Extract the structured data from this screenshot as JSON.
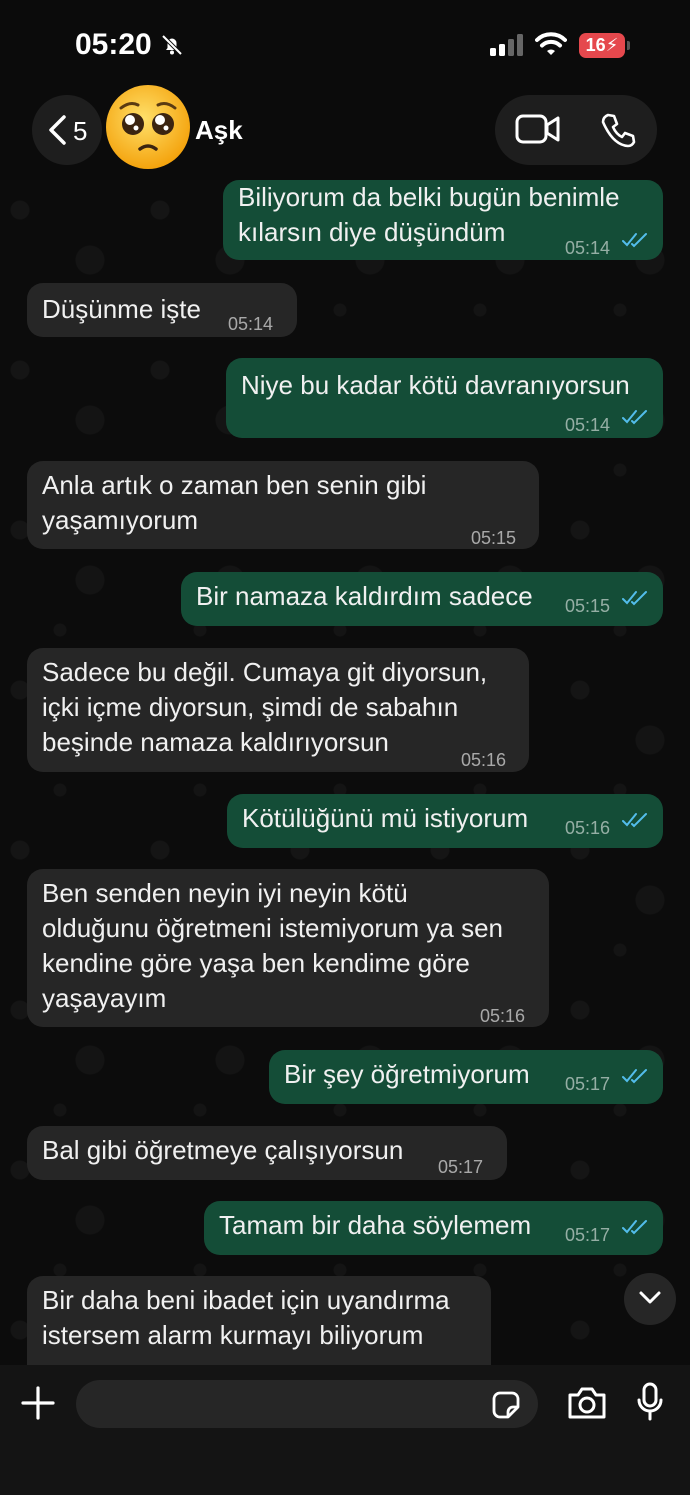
{
  "status_bar": {
    "time": "05:20",
    "battery": "16"
  },
  "header": {
    "back_count": "5",
    "contact_name": "Aşk"
  },
  "messages": [
    {
      "text": "Biliyorum da belki bugün benimle\nkılarsın diye düşündüm",
      "time": "05:14",
      "direction": "out"
    },
    {
      "text": "Düşünme işte",
      "time": "05:14",
      "direction": "in"
    },
    {
      "text": "Niye bu kadar kötü davranıyorsun",
      "time": "05:14",
      "direction": "out"
    },
    {
      "text": "Anla artık o zaman ben senin gibi\nyaşamıyorum",
      "time": "05:15",
      "direction": "in"
    },
    {
      "text": "Bir namaza kaldırdım sadece",
      "time": "05:15",
      "direction": "out"
    },
    {
      "text": "Sadece bu değil. Cumaya git diyorsun,\niçki içme diyorsun, şimdi de sabahın\nbeşinde namaza kaldırıyorsun",
      "time": "05:16",
      "direction": "in"
    },
    {
      "text": "Kötülüğünü mü istiyorum",
      "time": "05:16",
      "direction": "out"
    },
    {
      "text": "Ben senden neyin iyi neyin kötü\nolduğunu öğretmeni istemiyorum ya sen\nkendine göre yaşa ben kendime göre\nyaşayayım",
      "time": "05:16",
      "direction": "in"
    },
    {
      "text": "Bir şey öğretmiyorum",
      "time": "05:17",
      "direction": "out"
    },
    {
      "text": "Bal gibi öğretmeye çalışıyorsun",
      "time": "05:17",
      "direction": "in"
    },
    {
      "text": "Tamam bir daha söylemem",
      "time": "05:17",
      "direction": "out"
    },
    {
      "text": "Bir daha beni ibadet için uyandırma\nistersem alarm kurmayı biliyorum",
      "time": "",
      "direction": "in"
    }
  ],
  "composer": {
    "placeholder": ""
  },
  "colors": {
    "outgoing": "#144d37",
    "incoming": "#262626",
    "read_ticks": "#53bdeb"
  }
}
